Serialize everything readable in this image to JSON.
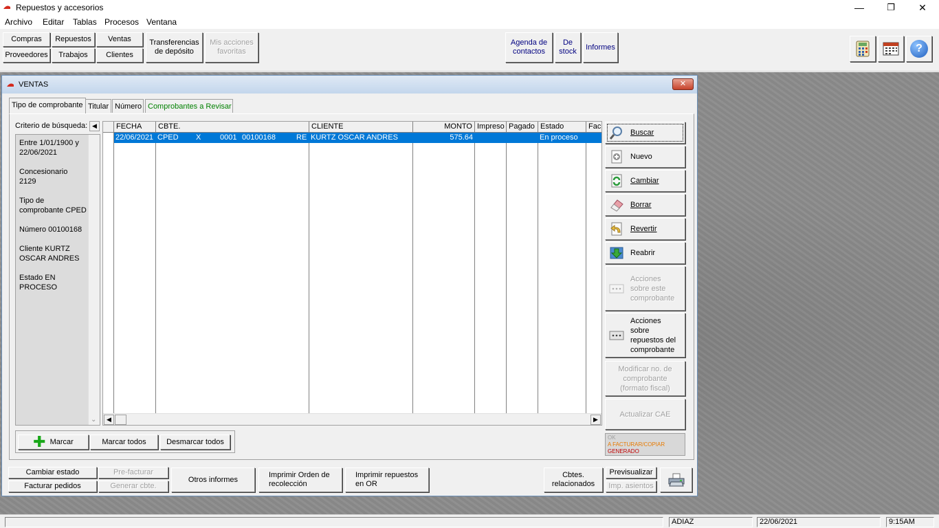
{
  "window": {
    "title": "Repuestos y accesorios",
    "minimize": "—",
    "maximize": "❐",
    "close": "✕"
  },
  "menu": [
    "Archivo",
    "Editar",
    "Tablas",
    "Procesos",
    "Ventana"
  ],
  "toolbar": {
    "compras": "Compras",
    "repuestos": "Repuestos",
    "ventas": "Ventas",
    "proveedores": "Proveedores",
    "trabajos": "Trabajos",
    "clientes": "Clientes",
    "transferencias_1": "Transferencias",
    "transferencias_2": "de depósito",
    "mis_acciones_1": "Mis acciones",
    "mis_acciones_2": "favoritas",
    "agenda_1": "Agenda de",
    "agenda_2": "contactos",
    "de_stock_1": "De",
    "de_stock_2": "stock",
    "informes": "Informes",
    "help": "?"
  },
  "child": {
    "title": "VENTAS",
    "close": "✕",
    "tabs": [
      "Tipo de comprobante",
      "Titular",
      "Número",
      "Comprobantes a Revisar"
    ],
    "criteria_label": "Criterio de búsqueda:",
    "criteria_arrow": "◀",
    "criteria": [
      "Entre  1/01/1900 y",
      "22/06/2021",
      "Concesionario",
      "2129",
      "Tipo de",
      "comprobante CPED",
      "Número 00100168",
      "Cliente KURTZ",
      "OSCAR ANDRES",
      "Estado EN",
      "PROCESO"
    ],
    "scroll_down": "⌄"
  },
  "grid": {
    "headers": [
      "FECHA",
      "CBTE.",
      "CLIENTE",
      "MONTO",
      "Impreso",
      "Pagado",
      "Estado",
      "Fac"
    ],
    "row": {
      "fecha": "22/06/2021",
      "tipo": "CPED",
      "letra": "X",
      "punto": "0001",
      "numero": "00100168",
      "extra": "RE",
      "cliente": "KURTZ OSCAR ANDRES",
      "monto": "575.64",
      "estado": "En proceso"
    },
    "scroll_left": "◀",
    "scroll_right": "▶"
  },
  "actions": {
    "buscar": "Buscar",
    "nuevo": "Nuevo",
    "cambiar": "Cambiar",
    "borrar": "Borrar",
    "revertir": "Revertir",
    "reabrir": "Reabrir",
    "acciones_comp_1": "Acciones",
    "acciones_comp_2": "sobre este",
    "acciones_comp_3": "comprobante",
    "acciones_rep_1": "Acciones",
    "acciones_rep_2": "sobre",
    "acciones_rep_3": "repuestos del",
    "acciones_rep_4": "comprobante",
    "modificar_1": "Modificar no. de",
    "modificar_2": "comprobante",
    "modificar_3": "(formato fiscal)",
    "actualizar_cae": "Actualizar CAE"
  },
  "legend": {
    "ok": "OK",
    "a_facturar": "A FACTURAR/COPIAR",
    "generado": "GENERADO"
  },
  "legend_colors": {
    "ok": "#a0a0a0",
    "a_facturar": "#e87a00",
    "generado": "#c00000"
  },
  "bottom": {
    "marcar": "Marcar",
    "plus": "✚",
    "marcar_todos": "Marcar todos",
    "desmarcar_todos": "Desmarcar todos",
    "cambiar_estado": "Cambiar estado",
    "pre_facturar": "Pre-facturar",
    "facturar_pedidos": "Facturar pedidos",
    "generar_cbte": "Generar cbte.",
    "otros_informes": "Otros informes",
    "imprimir_orden_1": "Imprimir Orden de",
    "imprimir_orden_2": "recolección",
    "imprimir_rep_1": "Imprimir repuestos",
    "imprimir_rep_2": "en OR",
    "cbtes_1": "Cbtes.",
    "cbtes_2": "relacionados",
    "previsualizar": "Previsualizar",
    "imp_asientos": "Imp. asientos"
  },
  "status": {
    "user": "ADIAZ",
    "date": "22/06/2021",
    "time": "9:15AM"
  }
}
